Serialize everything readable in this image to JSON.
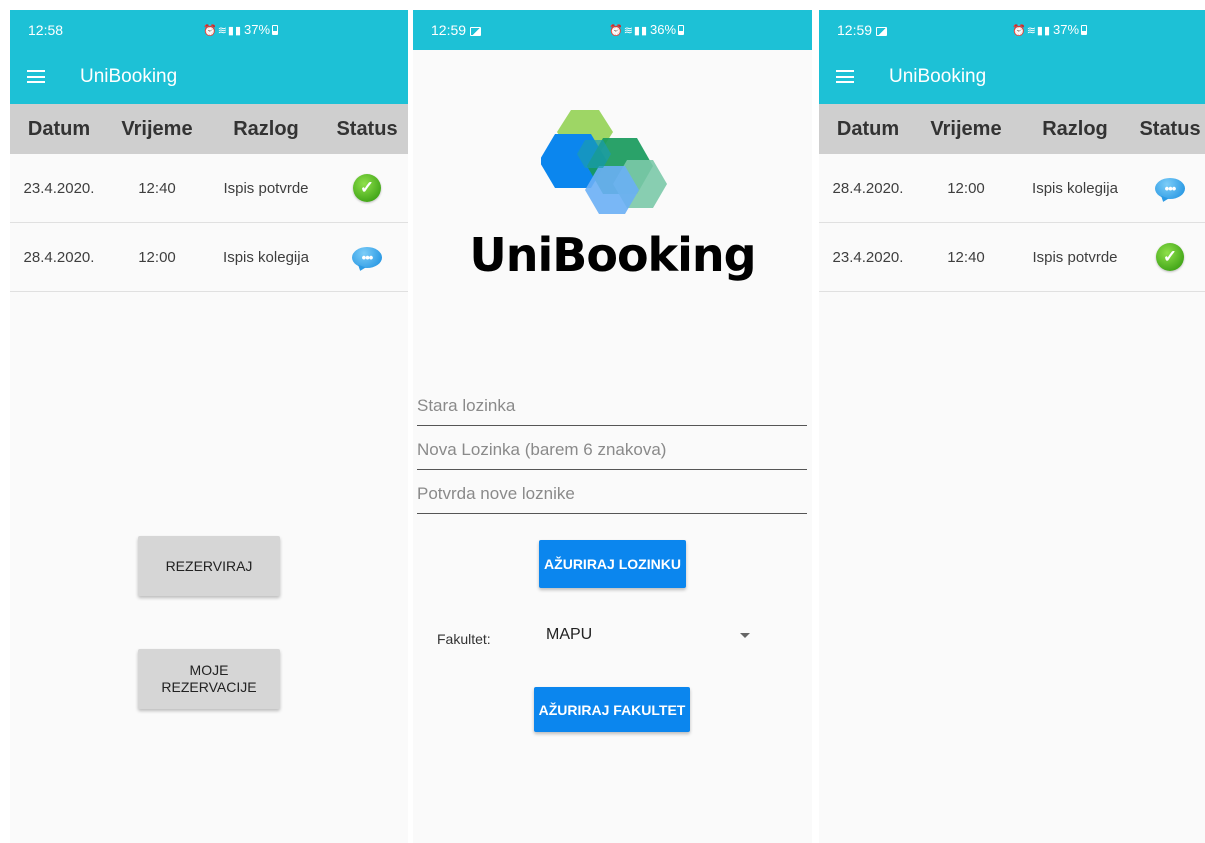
{
  "screen1": {
    "status": {
      "time": "12:58",
      "battery": "37%"
    },
    "app_title": "UniBooking",
    "table": {
      "headers": [
        "Datum",
        "Vrijeme",
        "Razlog",
        "Status"
      ],
      "rows": [
        {
          "date": "23.4.2020.",
          "time": "12:40",
          "reason": "Ispis potvrde",
          "status": "confirmed"
        },
        {
          "date": "28.4.2020.",
          "time": "12:00",
          "reason": "Ispis kolegija",
          "status": "pending"
        }
      ]
    },
    "buttons": {
      "reserve": "REZERVIRAJ",
      "my_reservations": "MOJE\nREZERVACIJE"
    }
  },
  "screen2": {
    "status": {
      "time": "12:59",
      "battery": "36%"
    },
    "brand": "UniBooking",
    "fields": {
      "old_password": "Stara lozinka",
      "new_password": "Nova Lozinka (barem 6 znakova)",
      "confirm_password": "Potvrda nove loznike"
    },
    "update_password_button": "AŽURIRAJ LOZINKU",
    "faculty": {
      "label": "Fakultet:",
      "selected": "MAPU"
    },
    "update_faculty_button": "AŽURIRAJ FAKULTET"
  },
  "screen3": {
    "status": {
      "time": "12:59",
      "battery": "37%"
    },
    "app_title": "UniBooking",
    "table": {
      "headers": [
        "Datum",
        "Vrijeme",
        "Razlog",
        "Status"
      ],
      "rows": [
        {
          "date": "28.4.2020.",
          "time": "12:00",
          "reason": "Ispis kolegija",
          "status": "pending"
        },
        {
          "date": "23.4.2020.",
          "time": "12:40",
          "reason": "Ispis potvrde",
          "status": "confirmed"
        }
      ]
    }
  },
  "colors": {
    "primary": "#1dc1d6",
    "header_gray": "#cfcfcf",
    "button_blue": "#0b86ee",
    "success_green": "#43a619",
    "pending_blue": "#2c9ae4"
  },
  "icons": {
    "confirmed": "check-circle-icon",
    "pending": "chat-bubble-icon",
    "menu": "hamburger-menu-icon"
  }
}
